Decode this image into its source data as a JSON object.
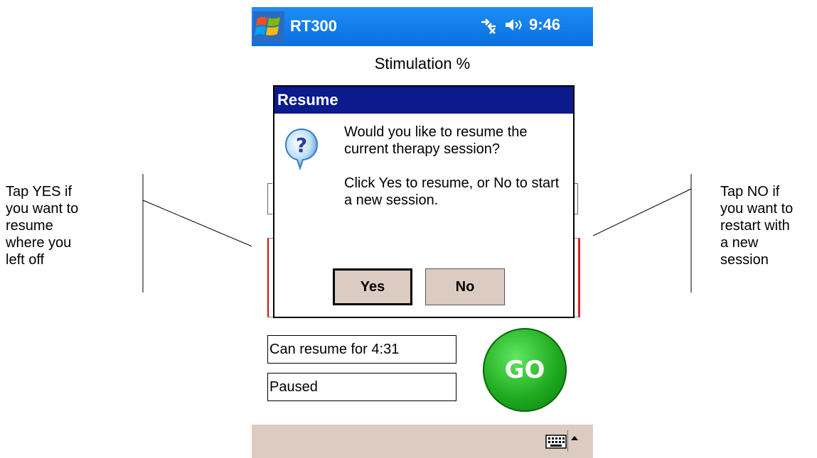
{
  "callouts": {
    "left": "Tap YES if\nyou want to\nresume\nwhere you\nleft off",
    "right": "Tap NO if\nyou want to\nrestart with\na new\nsession"
  },
  "titlebar": {
    "app_title": "RT300",
    "time": "9:46",
    "start_icon": "windows-flag-icon",
    "status_icons": [
      "connectivity-x-icon",
      "speaker-muted-icon"
    ],
    "color": "#1a84ee"
  },
  "screen": {
    "title": "Stimulation %"
  },
  "dialog": {
    "title": "Resume",
    "icon": "question-icon",
    "message_1": "Would you like to resume the current therapy session?",
    "message_2": "Click Yes to resume, or No to start a new session.",
    "yes_label": "Yes",
    "no_label": "No",
    "title_color": "#0b1a8c"
  },
  "status": {
    "resume_text": "Can resume for 4:31",
    "state_text": "Paused"
  },
  "go_button": {
    "label": "GO",
    "color": "#1faa1f"
  },
  "bottom_bar": {
    "icons": [
      "keyboard-icon",
      "arrow-up-icon"
    ]
  }
}
